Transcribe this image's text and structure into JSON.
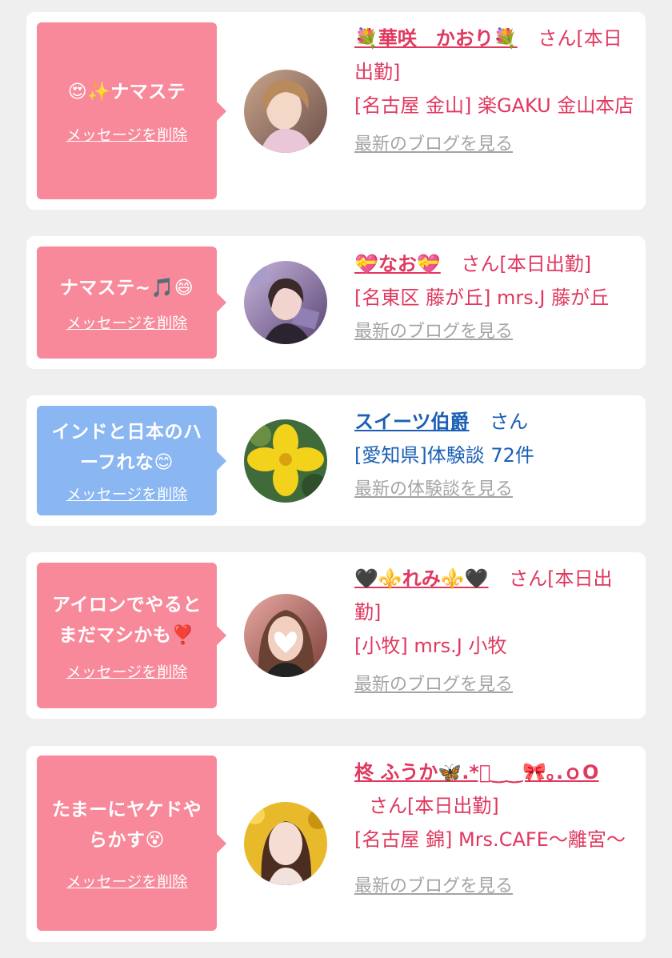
{
  "cards": [
    {
      "bubble_message": "😍✨ナマステ",
      "bubble_delete": "メッセージを削除",
      "name": "💐華咲　かおり💐",
      "honorific": "さん[本日出勤]",
      "shop": "[名古屋 金山] 楽GAKU 金山本店",
      "link": "最新のブログを見る"
    },
    {
      "bubble_message": "ナマステ~🎵😄",
      "bubble_delete": "メッセージを削除",
      "name": "💝なお💝",
      "honorific": "さん[本日出勤]",
      "shop": "[名東区 藤が丘] mrs.J 藤が丘",
      "link": "最新のブログを見る"
    },
    {
      "bubble_message": "インドと日本のハーフれな😊",
      "bubble_delete": "メッセージを削除",
      "name": "スイーツ伯爵",
      "honorific": "さん",
      "shop": "[愛知県]体験談 72件",
      "link": "最新の体験談を見る"
    },
    {
      "bubble_message": "アイロンでやるとまだマシかも❣️",
      "bubble_delete": "メッセージを削除",
      "name": "🖤⚜️れみ⚜️🖤",
      "honorific": "さん[本日出勤]",
      "shop": "[小牧] mrs.J 小牧",
      "link": "最新のブログを見る"
    },
    {
      "bubble_message": "たまーにヤケドやらかす😵",
      "bubble_delete": "メッセージを削除",
      "name": "柊 ふうか🦋.*ﾟ‿‿🎀｡.ｏO",
      "honorific": "さん[本日出勤]",
      "shop": "[名古屋 錦] Mrs.CAFE〜離宮〜",
      "link": "最新のブログを見る"
    }
  ],
  "colors": {
    "pink_bubble": "#f7899a",
    "blue_bubble": "#8ab6f2",
    "cast_name": "#e0385e",
    "reviewer_name": "#1a5fb4",
    "link_gray": "#a4a4a4"
  }
}
